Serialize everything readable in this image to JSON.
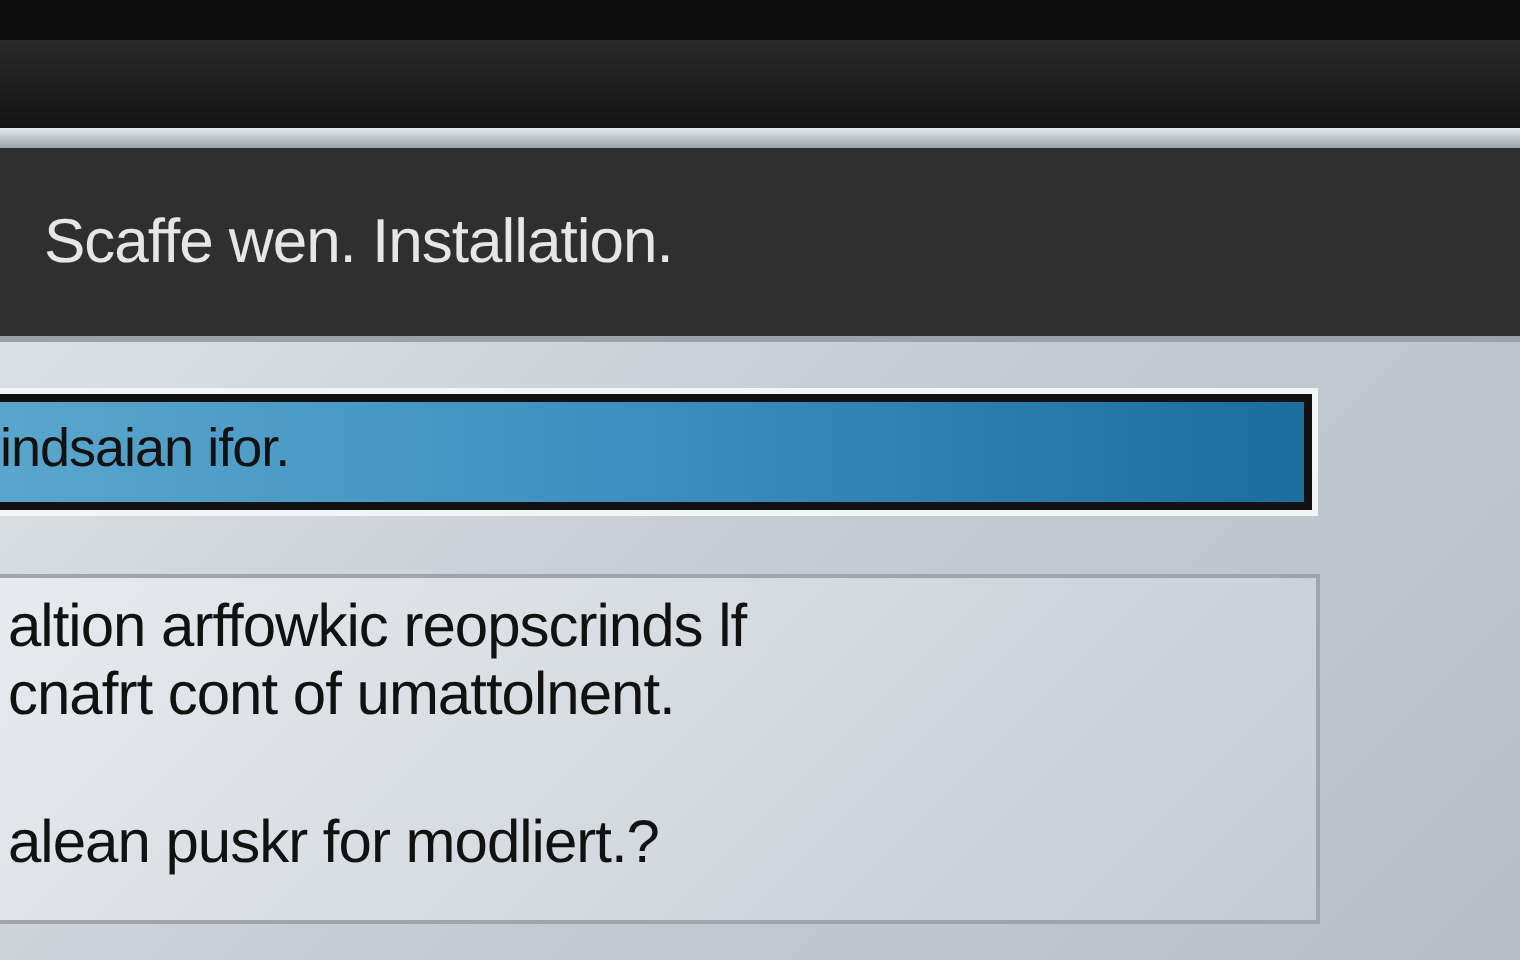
{
  "window": {
    "title": "Scaffe wen. Installation."
  },
  "progress": {
    "label": "indsaian ifor.",
    "level": 1
  },
  "message": {
    "lines": [
      "altion arffowkic reopscrinds lf",
      "cnafrt cont of umattolnent."
    ],
    "question": "alean puskr for modliert.?"
  }
}
